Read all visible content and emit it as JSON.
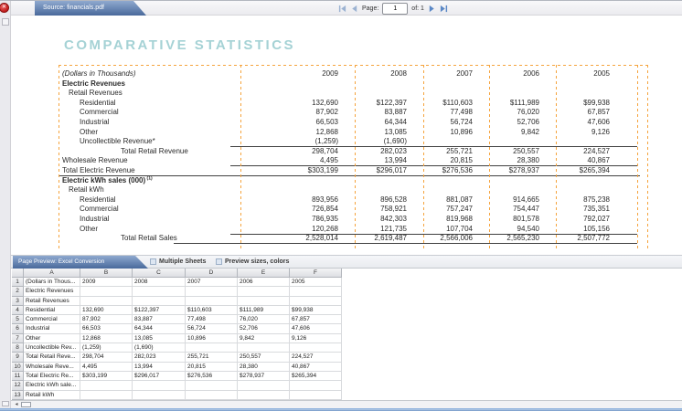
{
  "source_tab": {
    "label": "Source: financials.pdf"
  },
  "pager": {
    "page_label": "Page:",
    "page_value": "1",
    "of_label": "of: 1"
  },
  "pdf": {
    "title": "COMPARATIVE STATISTICS",
    "table": {
      "rows": [
        {
          "label": "(Dollars in Thousands)",
          "italic": true,
          "indent": 0,
          "years": true,
          "values": [
            "2009",
            "2008",
            "2007",
            "2006",
            "2005"
          ]
        },
        {
          "label": "Electric Revenues",
          "bold": true,
          "indent": 0,
          "values": [
            "",
            "",
            "",
            "",
            ""
          ]
        },
        {
          "label": "Retail Revenues",
          "indent": 1,
          "values": [
            "",
            "",
            "",
            "",
            ""
          ]
        },
        {
          "label": "Residential",
          "indent": 2,
          "values": [
            "132,690",
            "$122,397",
            "$110,603",
            "$111,989",
            "$99,938"
          ]
        },
        {
          "label": "Commercial",
          "indent": 2,
          "values": [
            "87,902",
            "83,887",
            "77,498",
            "76,020",
            "67,857"
          ]
        },
        {
          "label": "Industrial",
          "indent": 2,
          "values": [
            "66,503",
            "64,344",
            "56,724",
            "52,706",
            "47,606"
          ]
        },
        {
          "label": "Other",
          "indent": 2,
          "values": [
            "12,868",
            "13,085",
            "10,896",
            "9,842",
            "9,126"
          ]
        },
        {
          "label": "Uncollectible Revenue*",
          "indent": 2,
          "values": [
            "(1,259)",
            "(1,690)",
            "",
            "",
            ""
          ]
        },
        {
          "label": "Total Retail Revenue",
          "indent": 3,
          "rule": "nums",
          "values": [
            "298,704",
            "282,023",
            "255,721",
            "250,557",
            "224,527"
          ]
        },
        {
          "label": "Wholesale Revenue",
          "indent": 0,
          "values": [
            "4,495",
            "13,994",
            "20,815",
            "28,380",
            "40,867"
          ]
        },
        {
          "label": "Total Electric Revenue",
          "indent": 0,
          "rule": "nums",
          "values": [
            "$303,199",
            "$296,017",
            "$276,536",
            "$278,937",
            "$265,394"
          ]
        },
        {
          "label": "Electric kWh sales (000)",
          "sup": "(1)",
          "bold": true,
          "indent": 0,
          "rule": "full",
          "values": [
            "",
            "",
            "",
            "",
            ""
          ]
        },
        {
          "label": "Retail kWh",
          "indent": 1,
          "values": [
            "",
            "",
            "",
            "",
            ""
          ]
        },
        {
          "label": "Residential",
          "indent": 2,
          "values": [
            "893,956",
            "896,528",
            "881,087",
            "914,665",
            "875,238"
          ]
        },
        {
          "label": "Commercial",
          "indent": 2,
          "values": [
            "726,854",
            "758,921",
            "757,247",
            "754,447",
            "735,351"
          ]
        },
        {
          "label": "Industrial",
          "indent": 2,
          "values": [
            "786,935",
            "842,303",
            "819,968",
            "801,578",
            "792,027"
          ]
        },
        {
          "label": "Other",
          "indent": 2,
          "values": [
            "120,268",
            "121,735",
            "107,704",
            "94,540",
            "105,156"
          ]
        },
        {
          "label": "Total Retail Sales",
          "indent": 3,
          "rule": "last",
          "values": [
            "2,528,014",
            "2,619,487",
            "2,566,006",
            "2,565,230",
            "2,507,772"
          ]
        }
      ]
    }
  },
  "preview": {
    "tab_label": "Page Preview: Excel Conversion",
    "checkbox_multiple_sheets": "Multiple Sheets",
    "checkbox_preview_sizes": "Preview sizes, colors",
    "columns": [
      "A",
      "B",
      "C",
      "D",
      "E",
      "F"
    ],
    "rows": [
      {
        "n": "1",
        "cells": [
          "(Dollars in Thous...",
          "2009",
          "2008",
          "2007",
          "2006",
          "2005"
        ]
      },
      {
        "n": "2",
        "cells": [
          "Electric Revenues",
          "",
          "",
          "",
          "",
          ""
        ]
      },
      {
        "n": "3",
        "cells": [
          "Retail Revenues",
          "",
          "",
          "",
          "",
          ""
        ]
      },
      {
        "n": "4",
        "cells": [
          "Residential",
          "132,690",
          "$122,397",
          "$110,603",
          "$111,989",
          "$99,938"
        ]
      },
      {
        "n": "5",
        "cells": [
          "Commercial",
          "87,902",
          "83,887",
          "77,498",
          "76,020",
          "67,857"
        ]
      },
      {
        "n": "6",
        "cells": [
          "Industrial",
          "66,503",
          "64,344",
          "56,724",
          "52,706",
          "47,606"
        ]
      },
      {
        "n": "7",
        "cells": [
          "Other",
          "12,868",
          "13,085",
          "10,896",
          "9,842",
          "9,126"
        ]
      },
      {
        "n": "8",
        "cells": [
          "Uncollectible Rev...",
          "(1,259)",
          "(1,690)",
          "",
          "",
          ""
        ]
      },
      {
        "n": "9",
        "cells": [
          "Total Retail Reve...",
          "298,704",
          "282,023",
          "255,721",
          "250,557",
          "224,527"
        ]
      },
      {
        "n": "10",
        "cells": [
          "Wholesale Reve...",
          "4,495",
          "13,994",
          "20,815",
          "28,380",
          "40,867"
        ]
      },
      {
        "n": "11",
        "cells": [
          "Total Electric Re...",
          "$303,199",
          "$296,017",
          "$276,536",
          "$278,937",
          "$265,394"
        ]
      },
      {
        "n": "12",
        "cells": [
          "Electric kWh sale...",
          "",
          "",
          "",
          "",
          ""
        ]
      },
      {
        "n": "13",
        "cells": [
          "Retail kWh",
          "",
          "",
          "",
          "",
          ""
        ]
      }
    ]
  },
  "colors": {
    "tab_blue_top": "#8fa9cf",
    "tab_blue_bottom": "#49699b",
    "marker_orange": "#f5a33c",
    "title_teal": "#a5d2d5",
    "status_blue": "#4d79b2",
    "close_red": "#c11d1d"
  }
}
